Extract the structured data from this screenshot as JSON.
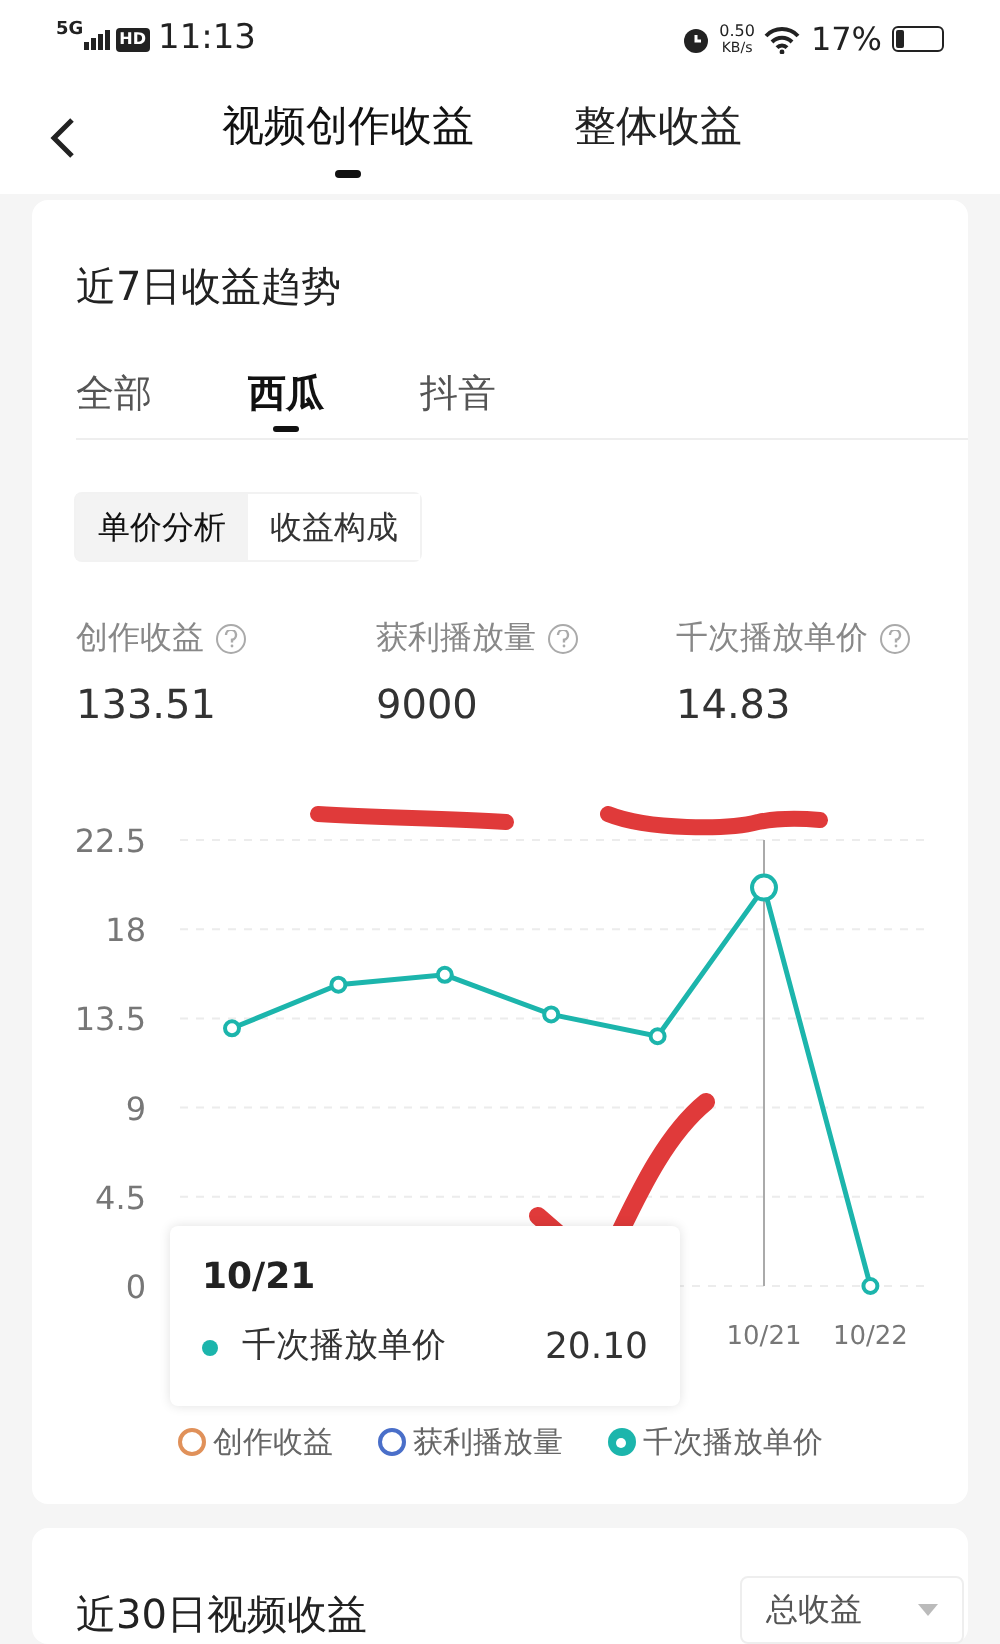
{
  "status_bar": {
    "network": "5G",
    "hd": "HD",
    "time": "11:13",
    "speed_value": "0.50",
    "speed_unit": "KB/s",
    "battery": "17%"
  },
  "header": {
    "tabs": [
      {
        "label": "视频创作收益",
        "selected": true
      },
      {
        "label": "整体收益",
        "selected": false
      }
    ]
  },
  "trend_card": {
    "title": "近7日收益趋势",
    "platform_tabs": [
      {
        "label": "全部",
        "selected": false
      },
      {
        "label": "西瓜",
        "selected": true
      },
      {
        "label": "抖音",
        "selected": false
      }
    ],
    "segments": [
      {
        "label": "单价分析",
        "selected": true
      },
      {
        "label": "收益构成",
        "selected": false
      }
    ],
    "metrics": [
      {
        "label": "创作收益",
        "value": "133.51"
      },
      {
        "label": "获利播放量",
        "value": "9000"
      },
      {
        "label": "千次播放单价",
        "value": "14.83"
      }
    ],
    "chart_data": {
      "type": "line",
      "grid": true,
      "ylim": [
        0,
        22.5
      ],
      "yticks": [
        {
          "value": 0,
          "label": "0"
        },
        {
          "value": 4.5,
          "label": "4.5"
        },
        {
          "value": 9,
          "label": "9"
        },
        {
          "value": 13.5,
          "label": "13.5"
        },
        {
          "value": 18,
          "label": "18"
        },
        {
          "value": 22.5,
          "label": "22.5"
        }
      ],
      "series": [
        {
          "name": "千次播放单价",
          "color": "#1cb5ac",
          "marker": true,
          "values": [
            13,
            15.2,
            15.7,
            13.7,
            12.6,
            20.1,
            0
          ]
        }
      ]
    },
    "x_axis_labels": [
      "10/21",
      "10/22"
    ],
    "tooltip": {
      "date": "10/21",
      "value": "20.10"
    },
    "legend": [
      {
        "label": "创作收益",
        "color": "#e0915a",
        "selected": false
      },
      {
        "label": "获利播放量",
        "color": "#4a6fc9",
        "selected": false
      },
      {
        "label": "千次播放单价",
        "color": "#1cb5ac",
        "selected": true
      }
    ]
  },
  "video_card": {
    "title": "近30日视频收益",
    "dropdown": "总收益"
  }
}
